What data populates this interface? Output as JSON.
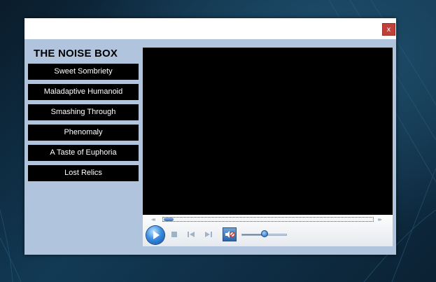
{
  "app": {
    "title": "THE NOISE BOX",
    "close_label": "x"
  },
  "tracks": [
    {
      "label": "Sweet Sombriety"
    },
    {
      "label": "Maladaptive Humanoid"
    },
    {
      "label": "Smashing Through"
    },
    {
      "label": "Phenomaly"
    },
    {
      "label": "A Taste of Euphoria"
    },
    {
      "label": "Lost Relics"
    }
  ],
  "player": {
    "seek_position": 0.0,
    "volume_level": 0.5,
    "controls": [
      "play-icon",
      "stop-icon",
      "previous-icon",
      "next-icon",
      "mute-icon"
    ],
    "seek_back_glyph": "◂◂",
    "seek_forward_glyph": "▸▸"
  },
  "colors": {
    "window_background": "#b0c4de",
    "track_button": "#000000",
    "close_button": "#c0403a",
    "accent": "#2f6cc0"
  }
}
